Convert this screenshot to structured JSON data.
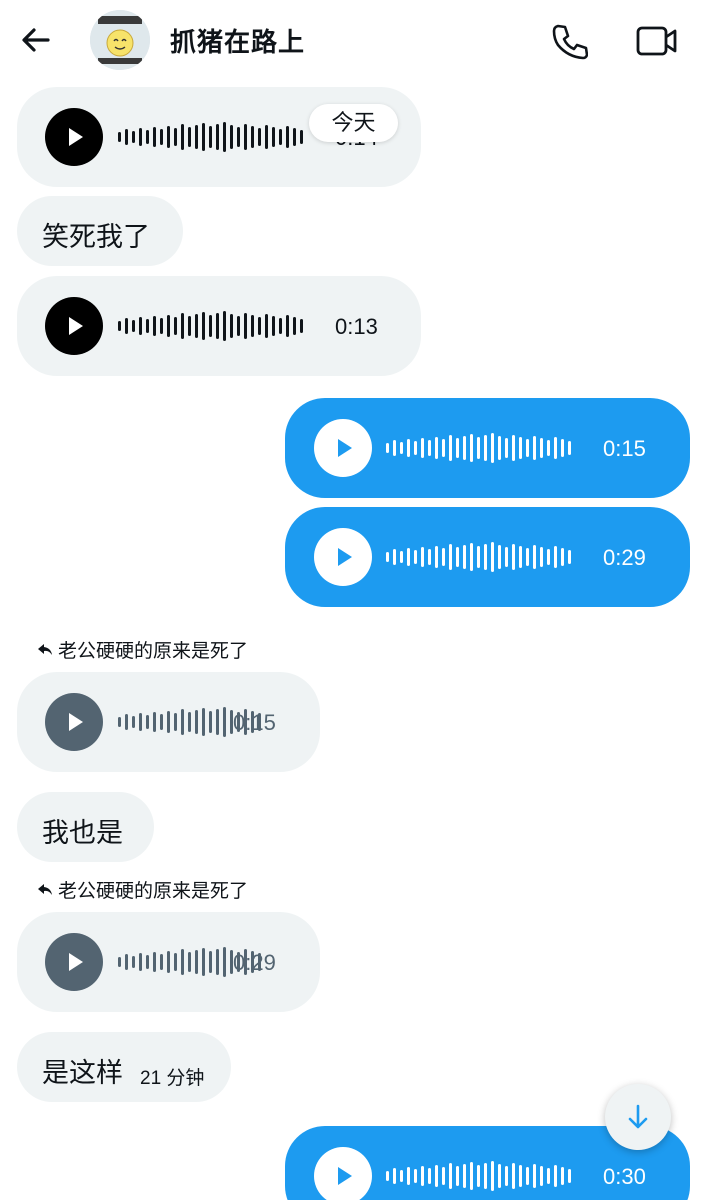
{
  "header": {
    "title": "抓猪在路上",
    "back_icon": "arrow-left-icon",
    "call_icon": "phone-icon",
    "video_icon": "video-camera-icon"
  },
  "date_divider": "今天",
  "messages": [
    {
      "type": "voice",
      "direction": "in",
      "duration": "0:14"
    },
    {
      "type": "text",
      "direction": "in",
      "text": "笑死我了"
    },
    {
      "type": "voice",
      "direction": "in",
      "duration": "0:13"
    },
    {
      "type": "voice",
      "direction": "out",
      "duration": "0:15"
    },
    {
      "type": "voice",
      "direction": "out",
      "duration": "0:29"
    },
    {
      "type": "voice",
      "direction": "in",
      "reply_to": "老公硬硬的原来是死了",
      "duration": "0:15"
    },
    {
      "type": "text",
      "direction": "in",
      "text": "我也是"
    },
    {
      "type": "voice",
      "direction": "in",
      "reply_to": "老公硬硬的原来是死了",
      "duration": "0:29"
    },
    {
      "type": "text",
      "direction": "in",
      "text": "是这样",
      "time": "21 分钟"
    },
    {
      "type": "voice",
      "direction": "out",
      "duration": "0:30"
    }
  ],
  "scroll_down_icon": "arrow-down-icon",
  "colors": {
    "accent": "#1d9bf0",
    "incoming_bubble": "#eff3f4",
    "text": "#0f1419",
    "muted": "#536471"
  }
}
